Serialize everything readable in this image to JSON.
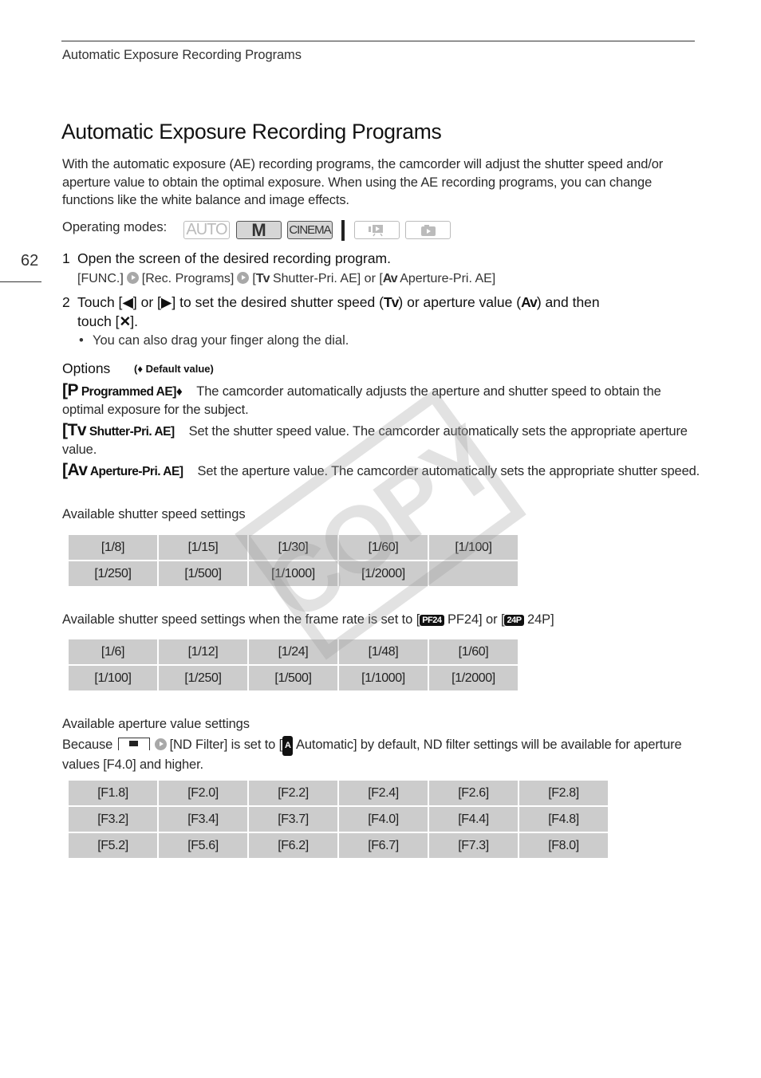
{
  "header": {
    "running_title": "Automatic Exposure Recording Programs",
    "page_number": "62"
  },
  "title": "Automatic Exposure Recording Programs",
  "intro": "With the automatic exposure (AE) recording programs, the camcorder will adjust the shutter speed and/or aperture value to obtain the optimal exposure. When using the AE recording programs, you can change functions like the white balance and image effects.",
  "operating_modes": {
    "label": "Operating modes:",
    "modes": [
      {
        "name": "AUTO",
        "active": false
      },
      {
        "name": "M",
        "active": true
      },
      {
        "name": "CINEMA",
        "active": true
      },
      {
        "name": "video-playback-icon",
        "active": false
      },
      {
        "name": "photo-playback-icon",
        "active": false
      }
    ]
  },
  "steps": [
    {
      "num": "1",
      "text": "Open the screen of the desired recording program.",
      "sub": {
        "func": "[FUNC.]",
        "rec": "[Rec. Programs]",
        "tv_open": "[",
        "tv_symbol": "Tv",
        "tv_label": "Shutter-Pri. AE] or [",
        "av_symbol": "Av",
        "av_label": "Aperture-Pri. AE]"
      }
    },
    {
      "num": "2",
      "part1": "Touch [",
      "left_arrow": "◀",
      "part2": "] or [",
      "right_arrow": "▶",
      "part3": "] to set the desired shutter speed (",
      "tv_symbol": "Tv",
      "part4": ") or aperture value (",
      "av_symbol": "Av",
      "part5": ") and then",
      "line2_a": "touch [",
      "close_symbol": "✕",
      "line2_b": "]."
    }
  ],
  "bullet": "You can also drag your finger along the dial.",
  "options": {
    "heading": "Options",
    "note": "(♦ Default value)",
    "items": [
      {
        "symbol": "P",
        "label": "Programmed AE]♦",
        "open": "[",
        "desc": "The camcorder automatically adjusts the aperture and shutter speed to obtain the optimal exposure for the subject."
      },
      {
        "symbol": "Tv",
        "label": "Shutter-Pri. AE]",
        "open": "[",
        "desc": "Set the shutter speed value. The camcorder automatically sets the appropriate aperture value."
      },
      {
        "symbol": "Av",
        "label": "Aperture-Pri. AE]",
        "open": "[",
        "desc": "Set the aperture value. The camcorder automatically sets the appropriate shutter speed."
      }
    ]
  },
  "shutter_section": {
    "label": "Available shutter speed settings",
    "rows": [
      [
        "[1/8]",
        "[1/15]",
        "[1/30]",
        "[1/60]",
        "[1/100]"
      ],
      [
        "[1/250]",
        "[1/500]",
        "[1/1000]",
        "[1/2000]",
        ""
      ]
    ]
  },
  "shutter_24_section": {
    "label_a": "Available shutter speed settings when the frame rate is set to [",
    "badge1": "PF24",
    "label_b": " PF24] or [",
    "badge2": "24P",
    "label_c": " 24P]",
    "rows": [
      [
        "[1/6]",
        "[1/12]",
        "[1/24]",
        "[1/48]",
        "[1/60]"
      ],
      [
        "[1/100]",
        "[1/250]",
        "[1/500]",
        "[1/1000]",
        "[1/2000]"
      ]
    ]
  },
  "aperture_section": {
    "label": "Available aperture value settings",
    "body_a": "Because ",
    "body_b": "[ND Filter] is set to [",
    "badge": "A",
    "body_c": " Automatic] by default, ND filter settings will be available for aperture values [F4.0] and higher.",
    "rows": [
      [
        "[F1.8]",
        "[F2.0]",
        "[F2.2]",
        "[F2.4]",
        "[F2.6]",
        "[F2.8]"
      ],
      [
        "[F3.2]",
        "[F3.4]",
        "[F3.7]",
        "[F4.0]",
        "[F4.4]",
        "[F4.8]"
      ],
      [
        "[F5.2]",
        "[F5.6]",
        "[F6.2]",
        "[F6.7]",
        "[F7.3]",
        "[F8.0]"
      ]
    ]
  },
  "watermark": "COPY"
}
